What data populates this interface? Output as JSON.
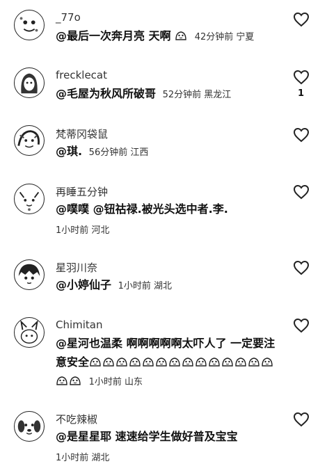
{
  "comments": [
    {
      "user": "_77o",
      "text": "@最后一次奔月亮 天啊",
      "emoji_count": 1,
      "meta": "42分钟前 宁夏",
      "likes": ""
    },
    {
      "user": "frecklecat",
      "text": "@毛屋为秋风所破哥",
      "emoji_count": 0,
      "meta": "52分钟前 黑龙江",
      "likes": "1"
    },
    {
      "user": "梵蒂冈袋鼠",
      "text": "@琪.",
      "emoji_count": 0,
      "meta": "56分钟前 江西",
      "likes": ""
    },
    {
      "user": "再睡五分钟",
      "text": "@噗噗 @钮祜禄.被光头选中者.李.",
      "emoji_count": 0,
      "meta": "1小时前 河北",
      "likes": ""
    },
    {
      "user": "星羽川奈",
      "text": "@小婷仙子",
      "emoji_count": 0,
      "meta": "1小时前 湖北",
      "likes": ""
    },
    {
      "user": "Chimitan",
      "text": "@星河也温柔 啊啊啊啊啊太吓人了 一定要注意安全",
      "emoji_count": 16,
      "meta": "1小时前 山东",
      "likes": ""
    },
    {
      "user": "不吃辣椒",
      "text": "@是星星耶 速速给学生做好普及宝宝",
      "emoji_count": 0,
      "meta": "1小时前 湖北",
      "likes": ""
    }
  ],
  "icons": {
    "like": "heart-outline-icon",
    "emoji": "hugging-emoji-icon"
  },
  "colors": {
    "text": "#111111",
    "meta": "#333333",
    "background": "#ffffff"
  }
}
